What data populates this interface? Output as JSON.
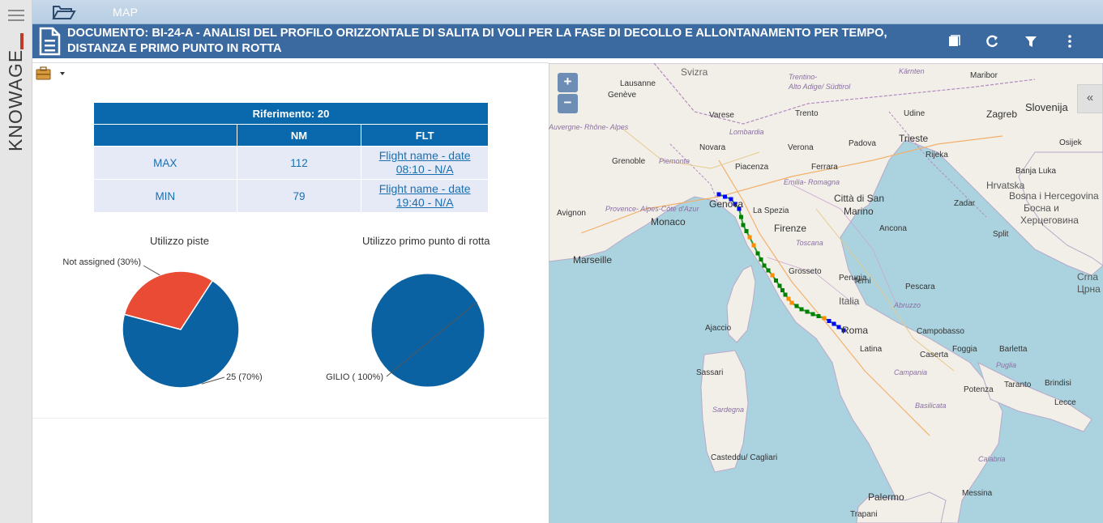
{
  "app": {
    "brand": "KNOWAGE",
    "tab_label": "MAP"
  },
  "document": {
    "title": "DOCUMENTO: BI-24-A - ANALISI DEL PROFILO ORIZZONTALE DI SALITA DI VOLI PER LA FASE DI DECOLLO E ALLONTANAMENTO PER TEMPO, DISTANZA E PRIMO PUNTO IN ROTTA"
  },
  "header_buttons": [
    "notes-icon",
    "refresh-icon",
    "filter-icon",
    "more-vertical-icon"
  ],
  "table": {
    "caption": "Riferimento: 20",
    "columns": [
      "",
      "NM",
      "FLT"
    ],
    "rows": [
      {
        "label": "MAX",
        "nm": "112",
        "flt_line1": "Flight name - date",
        "flt_line2": "08:10 - N/A"
      },
      {
        "label": "MIN",
        "nm": "79",
        "flt_line1": "Flight name - date",
        "flt_line2": "19:40 - N/A"
      }
    ]
  },
  "chart_data": [
    {
      "type": "pie",
      "title": "Utilizzo piste",
      "slices": [
        {
          "label": "Not assigned (30%)",
          "value": 30,
          "color": "#e94b35"
        },
        {
          "label": "25 (70%)",
          "value": 70,
          "color": "#0a62a3"
        }
      ]
    },
    {
      "type": "pie",
      "title": "Utilizzo primo punto di rotta",
      "slices": [
        {
          "label": "GILIO ( 100%)",
          "value": 100,
          "color": "#0a62a3"
        }
      ]
    }
  ],
  "map": {
    "zoom_in": "+",
    "zoom_out": "−",
    "collapse": "«",
    "labels": [
      "Svizra",
      "Lausanne",
      "Genève",
      "Varese",
      "Trento",
      "Alto Adige/ Südtirol",
      "Trentino-",
      "Kärnten",
      "Maribor",
      "Slovenija",
      "Zagreb",
      "Udine",
      "Lombardia",
      "Auvergne- Rhône- Alpes",
      "Grenoble",
      "Novara",
      "Verona",
      "Padova",
      "Trieste",
      "Rijeka",
      "Osijek",
      "Piemonte",
      "Piacenza",
      "Ferrara",
      "Hrvatska",
      "Banja Luka",
      "Emilia- Romagna",
      "Città di San",
      "Marino",
      "Bosna i Hercegovina",
      "Босна и",
      "Херцеговина",
      "Genova",
      "La Spezia",
      "Zadar",
      "Avignon",
      "Provence- Alpes-Côte d'Azur",
      "Monaco",
      "Firenze",
      "Ancona",
      "Split",
      "Toscana",
      "Marseille",
      "Perugia",
      "Grosseto",
      "Terni",
      "Pescara",
      "Italia",
      "Abruzzo",
      "Crna",
      "Црна",
      "Ajaccio",
      "Roma",
      "Campobasso",
      "Latina",
      "Caserta",
      "Foggia",
      "Barletta",
      "Campania",
      "Sassari",
      "Puglia",
      "Taranto",
      "Brindisi",
      "Potenza",
      "Lecce",
      "Sardegna",
      "Basilicata",
      "Calabria",
      "Casteddu/ Cagliari",
      "Palermo",
      "Messina",
      "Trapani"
    ],
    "legend_colors": {
      "departure": "#0000ff",
      "route": "#008000",
      "transition": "#ff8c00",
      "track": "#2e9e3a"
    }
  }
}
